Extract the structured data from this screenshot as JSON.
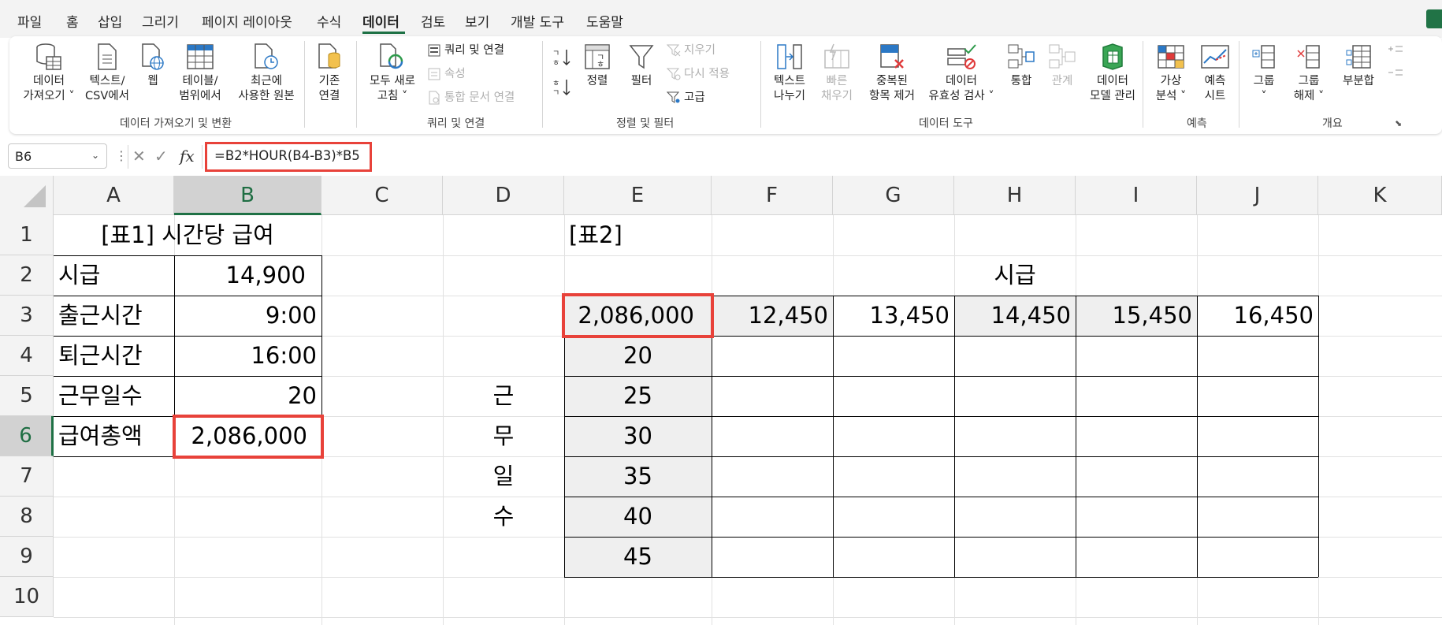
{
  "menu": {
    "tabs": [
      "파일",
      "홈",
      "삽입",
      "그리기",
      "페이지 레이아웃",
      "수식",
      "데이터",
      "검토",
      "보기",
      "개발 도구",
      "도움말"
    ],
    "active": "데이터"
  },
  "ribbon": {
    "get_data": {
      "l1": "데이터",
      "l2": "가져오기 ˅"
    },
    "text_csv": {
      "l1": "텍스트/",
      "l2": "CSV에서"
    },
    "web": {
      "l1": "웹"
    },
    "table_range": {
      "l1": "테이블/",
      "l2": "범위에서"
    },
    "recent": {
      "l1": "최근에",
      "l2": "사용한 원본"
    },
    "existing": {
      "l1": "기존",
      "l2": "연결"
    },
    "group1_label": "데이터 가져오기 및 변환",
    "refresh_all": {
      "l1": "모두 새로",
      "l2": "고침 ˅"
    },
    "queries_connections": "쿼리 및 연결",
    "properties": "속성",
    "edit_links": "통합 문서 연결",
    "group2_label": "쿼리 및 연결",
    "sort": "정렬",
    "filter": "필터",
    "clear": "지우기",
    "reapply": "다시 적용",
    "advanced": "고급",
    "group3_label": "정렬 및 필터",
    "text_to_columns": {
      "l1": "텍스트",
      "l2": "나누기"
    },
    "flash_fill": {
      "l1": "빠른",
      "l2": "채우기"
    },
    "remove_duplicates": {
      "l1": "중복된",
      "l2": "항목 제거"
    },
    "data_validation": {
      "l1": "데이터",
      "l2": "유효성 검사 ˅"
    },
    "consolidate": {
      "l1": "통합"
    },
    "relationships": {
      "l1": "관계"
    },
    "data_model": {
      "l1": "데이터",
      "l2": "모델 관리"
    },
    "group4_label": "데이터 도구",
    "what_if": {
      "l1": "가상",
      "l2": "분석 ˅"
    },
    "forecast_sheet": {
      "l1": "예측",
      "l2": "시트"
    },
    "group5_label": "예측",
    "group": {
      "l1": "그룹",
      "l2": "˅"
    },
    "ungroup": {
      "l1": "그룹",
      "l2": "해제 ˅"
    },
    "subtotal": {
      "l1": "부분합"
    },
    "group6_label": "개요"
  },
  "formula_bar": {
    "name_box": "B6",
    "fx": "fx",
    "formula": "=B2*HOUR(B4-B3)*B5"
  },
  "columns": [
    "A",
    "B",
    "C",
    "D",
    "E",
    "F",
    "G",
    "H",
    "I",
    "J",
    "K"
  ],
  "rows": [
    "1",
    "2",
    "3",
    "4",
    "5",
    "6",
    "7",
    "8",
    "9",
    "10"
  ],
  "selected_cell": "B6",
  "table1": {
    "title": "[표1]  시간당 급여",
    "labels": [
      "시급",
      "출근시간",
      "퇴근시간",
      "근무일수",
      "급여총액"
    ],
    "values": [
      "14,900",
      "9:00",
      "16:00",
      "20",
      "2,086,000"
    ]
  },
  "table2": {
    "title": "[표2]",
    "header_label": "시급",
    "corner_value": "2,086,000",
    "rates": [
      "12,450",
      "13,450",
      "14,450",
      "15,450",
      "16,450"
    ],
    "days": [
      "20",
      "25",
      "30",
      "35",
      "40",
      "45"
    ],
    "side_label": [
      "근",
      "무",
      "일",
      "수"
    ]
  },
  "colors": {
    "accent_green": "#1e7145",
    "highlight_red": "#e8423a",
    "header_bg": "#f3f3f3",
    "shade": "#efefef"
  }
}
